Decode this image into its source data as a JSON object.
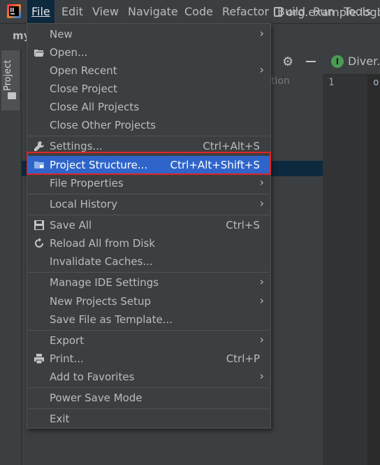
{
  "menubar": {
    "items": [
      {
        "label": "File"
      },
      {
        "label": "Edit"
      },
      {
        "label": "View"
      },
      {
        "label": "Navigate"
      },
      {
        "label": "Code"
      },
      {
        "label": "Refactor"
      },
      {
        "label": "Build"
      },
      {
        "label": "Run"
      },
      {
        "label": "Tools"
      }
    ]
  },
  "toolbar": {
    "project_short": "my",
    "breadcrumb": "org.example.logba"
  },
  "project_panel": {
    "tab_label": "Project",
    "column_label": "tion"
  },
  "editor": {
    "tab_label": "Diver.j",
    "tab_icon_letter": "I",
    "line_number": "1",
    "code_fragment": "o"
  },
  "file_menu": {
    "new": "New",
    "open": "Open...",
    "open_recent": "Open Recent",
    "close_project": "Close Project",
    "close_all_projects": "Close All Projects",
    "close_other_projects": "Close Other Projects",
    "settings": "Settings...",
    "settings_shortcut": "Ctrl+Alt+S",
    "project_structure": "Project Structure...",
    "project_structure_shortcut": "Ctrl+Alt+Shift+S",
    "file_properties": "File Properties",
    "local_history": "Local History",
    "save_all": "Save All",
    "save_all_shortcut": "Ctrl+S",
    "reload_from_disk": "Reload All from Disk",
    "invalidate_caches": "Invalidate Caches...",
    "manage_ide_settings": "Manage IDE Settings",
    "new_projects_setup": "New Projects Setup",
    "save_file_as_template": "Save File as Template...",
    "export": "Export",
    "print": "Print...",
    "print_shortcut": "Ctrl+P",
    "add_to_favorites": "Add to Favorites",
    "power_save_mode": "Power Save Mode",
    "exit": "Exit"
  },
  "colors": {
    "highlight": "#2f65ca",
    "annotation_box": "#e02424",
    "background": "#3c3f41"
  }
}
